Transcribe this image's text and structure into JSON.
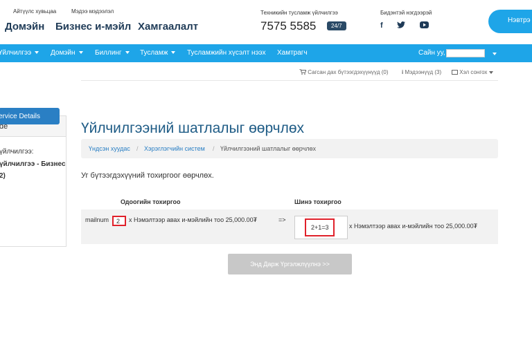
{
  "header": {
    "links": [
      "Айтүүлс хувьцаа",
      "Мэдээ мэдээлэл"
    ],
    "nav": [
      "Домэйн",
      "Бизнес и-мэйл",
      "Хамгаалалт"
    ],
    "support_label": "Техникийн тусламж үйлчилгээ",
    "support_phone": "7575 5585",
    "support_badge": "24/7",
    "social_label": "Бидэнтэй нэгдээрэй",
    "social_icons": [
      "facebook-icon",
      "twitter-icon",
      "youtube-icon"
    ],
    "cta_label": "Нэвтрэ"
  },
  "navbar": {
    "items": [
      "Үйлчилгээ",
      "Домэйн",
      "Биллинг",
      "Тусламж",
      "Тусламжийн хүсэлт нээх",
      "Хамтрагч"
    ],
    "greeting": "Сайн уу,",
    "color": "#1ea5e8"
  },
  "toolbar": {
    "cart": "Сагсан дах бүтээгдэхүүнүүд (0)",
    "notices": "Мэдээнүүд (3)",
    "language": "Хэл сонгох"
  },
  "sidebar": {
    "heading": "de",
    "lines": [
      "үйлчилгээ:",
      "үйлчилгээ - Бизнес",
      "2)"
    ],
    "button": "ervice Details"
  },
  "page": {
    "title": "Үйлчилгээний шатлалыг өөрчлөх",
    "breadcrumbs": [
      "Үндсэн хуудас",
      "Хэрэглэгчийн систем",
      "Үйлчилгээний шатлалыг өөрчлөх"
    ],
    "lead": "Уг бүтээгдэхүүний тохиргоог өөрчлөх.",
    "current_header": "Одоогийн тохиргоо",
    "new_header": "Шинэ тохиргоо",
    "option_name": "mailnum",
    "current_value": "2",
    "current_desc": "х Нэмэлтээр авах и-мэйлийн тоо 25,000.00₮",
    "arrow": "=>",
    "new_value": "2+1=3",
    "new_desc": "х Нэмэлтээр авах и-мэйлийн тоо 25,000.00₮",
    "continue": "Энд Дарж Үргэлжлүүлнэ >>"
  }
}
